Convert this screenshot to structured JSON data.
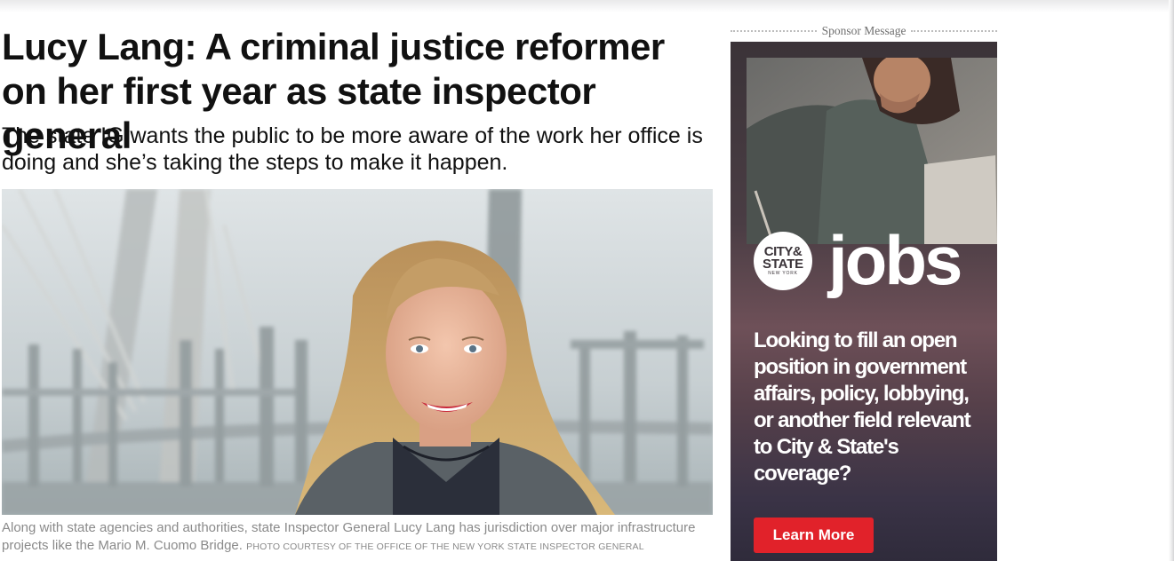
{
  "article": {
    "headline": "Lucy Lang: A criminal justice reformer on her first year as state inspector general",
    "dek": "The state IG wants the public to be more aware of the work her office is doing and she’s taking the steps to make it happen.",
    "caption": "Along with state agencies and authorities, state Inspector General Lucy Lang has jurisdiction over major infrastructure projects like the Mario M. Cuomo Bridge.",
    "photo_credit": "PHOTO COURTESY OF THE OFFICE OF THE NEW YORK STATE INSPECTOR GENERAL"
  },
  "sponsor": {
    "label": "Sponsor Message",
    "logo_line1": "CITY&",
    "logo_line2": "STATE",
    "logo_line3": "NEW YORK",
    "jobs_word": "jobs",
    "copy": "Looking to fill an open position in government affairs, policy, lobbying, or another field relevant to City & State's coverage?",
    "button_label": "Learn More",
    "button_color": "#e1222a"
  }
}
